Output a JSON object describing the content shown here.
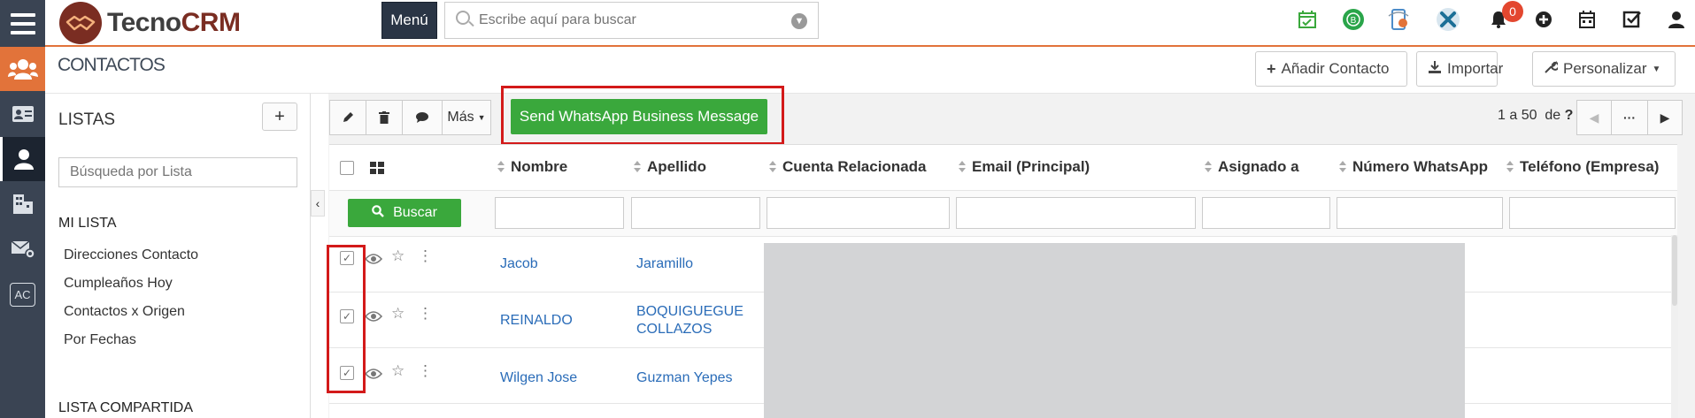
{
  "app": {
    "brand_part1": "Tecno",
    "brand_part2": "CRM",
    "menu_label": "Menú",
    "search_placeholder": "Escribe aquí para buscar",
    "notifications_count": "0",
    "brand_colors": {
      "topbar_accent": "#e2733a",
      "nav_bg": "#3a4453",
      "green": "#3aa83c",
      "highlight": "#d31a1a"
    }
  },
  "header": {
    "title": "CONTACTOS",
    "add_label": "Añadir Contacto",
    "import_label": "Importar",
    "customize_label": "Personalizar"
  },
  "leftnav": {
    "items": [
      "users-icon",
      "id-card-icon",
      "contact-icon",
      "building-icon",
      "mail-settings-icon",
      "ac-icon"
    ],
    "ac_label": "AC"
  },
  "lists": {
    "title": "LISTAS",
    "add_label": "+",
    "search_placeholder": "Búsqueda por Lista",
    "my_list_header": "MI LISTA",
    "my_list_items": [
      "Direcciones Contacto",
      "Cumpleaños Hoy",
      "Contactos x Origen",
      "Por Fechas"
    ],
    "shared_header": "LISTA COMPARTIDA"
  },
  "toolbar": {
    "more_label": "Más",
    "whatsapp_label": "Send WhatsApp Business Message",
    "page_info_range": "1 a 50",
    "page_info_de": "de",
    "page_info_total": "?"
  },
  "table": {
    "columns": [
      "Nombre",
      "Apellido",
      "Cuenta Relacionada",
      "Email (Principal)",
      "Asignado a",
      "Número WhatsApp",
      "Teléfono (Empresa)"
    ],
    "buscar_label": "Buscar",
    "rows": [
      {
        "nombre": "Jacob",
        "apellido_1": "Jaramillo",
        "apellido_2": "",
        "checked": true
      },
      {
        "nombre": "REINALDO",
        "apellido_1": "BOQUIGUEGUE",
        "apellido_2": "COLLAZOS",
        "checked": true
      },
      {
        "nombre": "Wilgen Jose",
        "apellido_1": "Guzman Yepes",
        "apellido_2": "",
        "checked": true
      }
    ]
  }
}
